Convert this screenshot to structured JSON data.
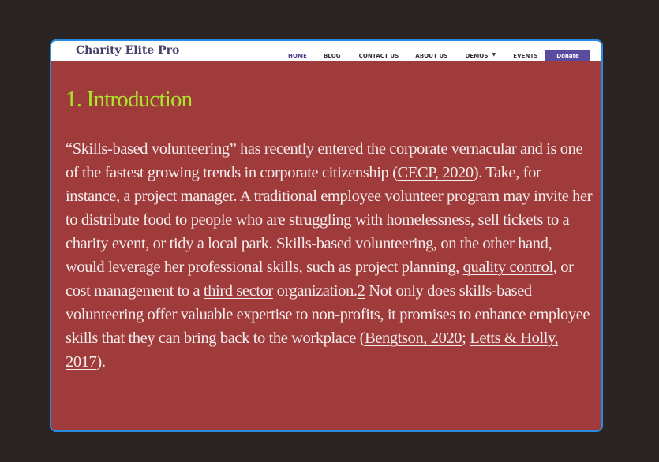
{
  "header": {
    "brand": "Charity Elite Pro",
    "nav": {
      "home": "HOME",
      "blog": "BLOG",
      "contact": "CONTACT US",
      "about": "ABOUT US",
      "demos": "DEMOS",
      "events": "EVENTS",
      "donate": "Donate"
    }
  },
  "article": {
    "heading": "1. Introduction",
    "segments": [
      "“Skills-based volunteering” has recently entered the corporate vernacular and is one of the fastest growing trends in corporate citizenship (",
      "CECP, 2020",
      "). Take, for instance, a project manager. A traditional employee volunteer program may invite her to distribute food to people who are struggling with homelessness, sell tickets to a charity event, or tidy a local park. Skills-based volunteering, on the other hand, would leverage her professional skills, such as project planning, ",
      "quality control",
      ", or cost management to a ",
      "third sector",
      " organization.",
      "2",
      " Not only does skills-based volunteering offer valuable expertise to non-profits, it promises to enhance employee skills that they can bring back to the workplace (",
      "Bengtson, 2020",
      "; ",
      "Letts & Holly, 2017",
      ")."
    ]
  },
  "colors": {
    "page_bg": "#2a2424",
    "frame_border": "#2a8ce0",
    "content_bg": "#a03b3c",
    "heading": "#a9e62a",
    "body_text": "#f4ecec",
    "donate_bg": "#5a4aa0"
  },
  "icons": {
    "demos_dropdown": "chevron-down-icon"
  }
}
